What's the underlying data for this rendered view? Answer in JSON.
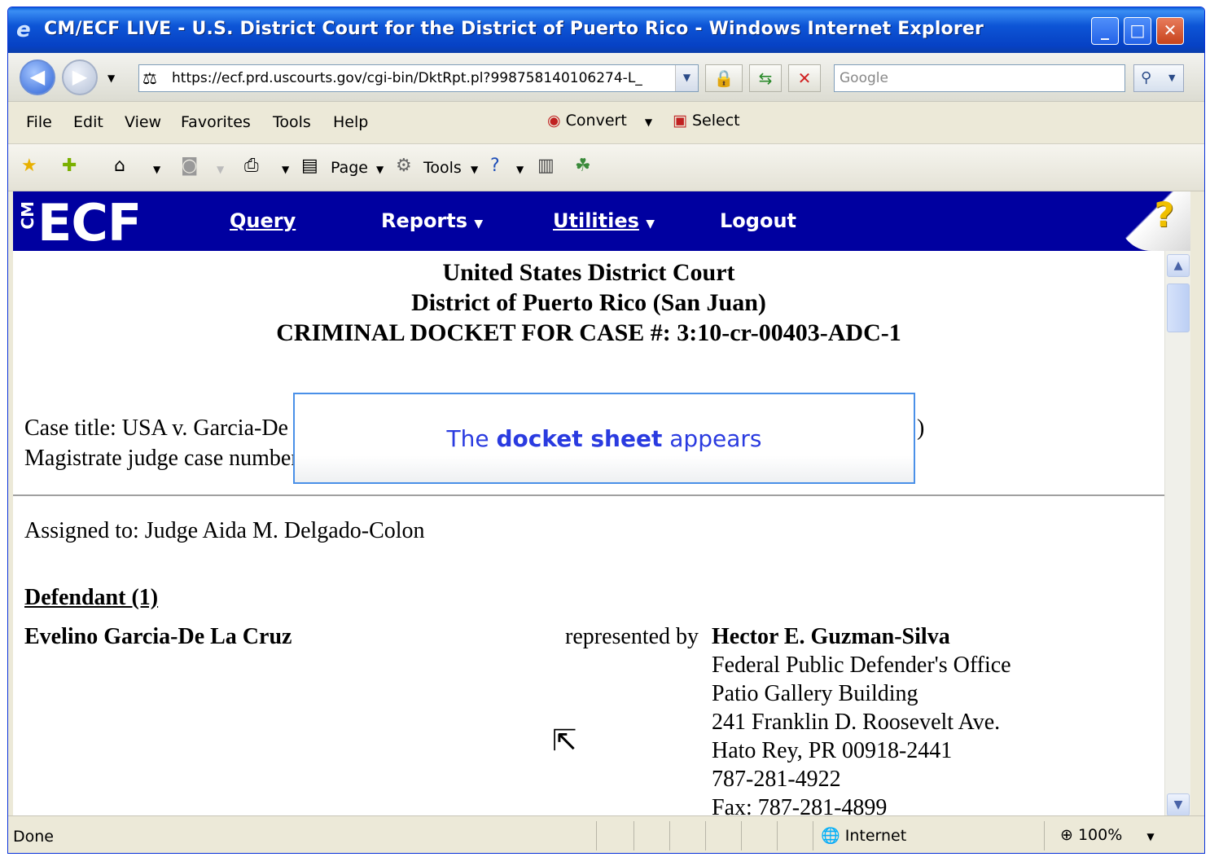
{
  "window": {
    "title": "CM/ECF LIVE - U.S. District Court for the District of Puerto Rico - Windows Internet Explorer",
    "minimize": "_",
    "maximize": "□",
    "close": "✕"
  },
  "address_bar": {
    "url": "https://ecf.prd.uscourts.gov/cgi-bin/DktRpt.pl?998758140106274-L_",
    "search_placeholder": "Google"
  },
  "menu": {
    "items": [
      "File",
      "Edit",
      "View",
      "Favorites",
      "Tools",
      "Help"
    ],
    "convert": "Convert",
    "select": "Select"
  },
  "command_bar": {
    "page": "Page",
    "tools": "Tools"
  },
  "ecf_nav": {
    "logo_cm": "CM",
    "logo_ecf": "ECF",
    "query": "Query",
    "reports": "Reports",
    "utilities": "Utilities",
    "logout": "Logout",
    "help": "?"
  },
  "docket": {
    "court": "United States District Court",
    "district": "District of Puerto Rico (San Juan)",
    "case_heading": "CRIMINAL DOCKET FOR CASE #: 3:10-cr-00403-ADC-1",
    "case_title_partial": "Case title: USA v. Garcia-De",
    "case_title_tail": ")",
    "magistrate_partial": "Magistrate judge case number",
    "assigned_to": "Assigned to: Judge Aida M. Delgado-Colon",
    "defendant_heading": "Defendant (1)",
    "defendant_name": "Evelino Garcia-De La Cruz",
    "represented_by": "represented by",
    "attorney": {
      "name": "Hector E. Guzman-Silva",
      "office": "Federal Public Defender's Office",
      "building": "Patio Gallery Building",
      "street": "241 Franklin D. Roosevelt Ave.",
      "city": "Hato Rey, PR 00918-2441",
      "phone": "787-281-4922",
      "fax": "Fax: 787-281-4899"
    }
  },
  "overlay": {
    "prefix": "The ",
    "emphasis": "docket sheet",
    "suffix": " appears"
  },
  "status_bar": {
    "status": "Done",
    "zone": "Internet",
    "zoom": "100%"
  }
}
